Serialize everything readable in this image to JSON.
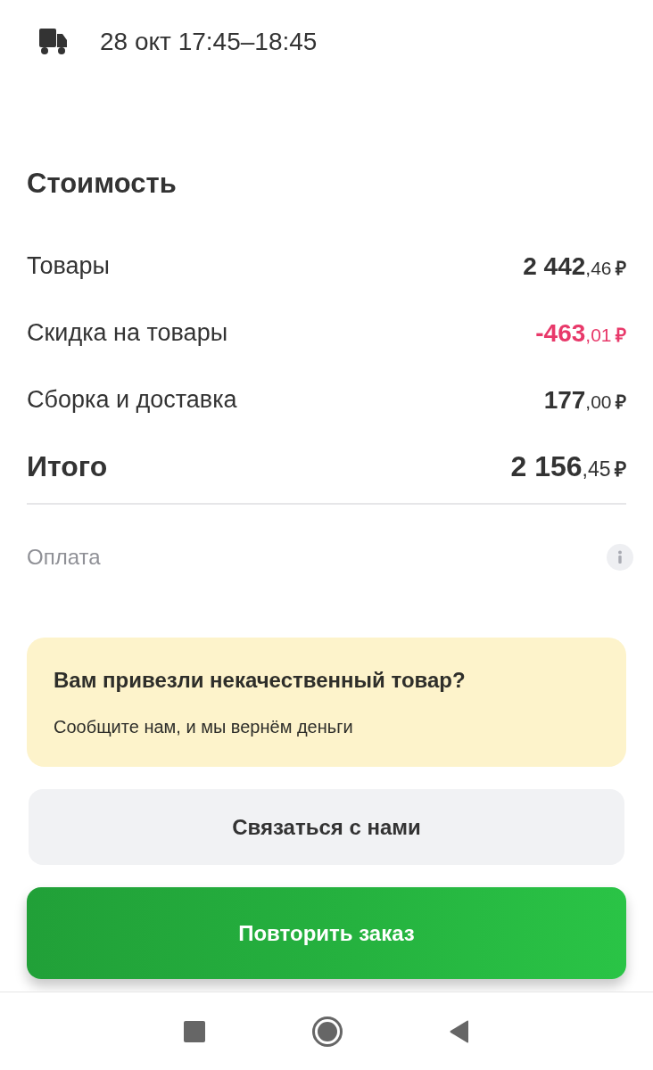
{
  "delivery": {
    "time": "28 окт 17:45–18:45"
  },
  "cost": {
    "title": "Стоимость",
    "rows": [
      {
        "kind": "item",
        "label": "Товары",
        "amount": "2 442",
        "fraction": ",46",
        "currency": "₽"
      },
      {
        "kind": "discount",
        "label": "Скидка на товары",
        "amount": "-463",
        "fraction": ",01",
        "currency": "₽"
      },
      {
        "kind": "item",
        "label": "Сборка и доставка",
        "amount": "177",
        "fraction": ",00",
        "currency": "₽"
      },
      {
        "kind": "total",
        "label": "Итого",
        "amount": "2 156",
        "fraction": ",45",
        "currency": "₽"
      }
    ],
    "payment": {
      "label": "Оплата"
    }
  },
  "banner": {
    "title": "Вам привезли некачественный товар?",
    "text": "Сообщите нам, и мы вернём деньги"
  },
  "buttons": [
    {
      "kind": "secondary",
      "label": "Связаться с нами"
    },
    {
      "kind": "primary",
      "label": "Повторить заказ"
    }
  ]
}
